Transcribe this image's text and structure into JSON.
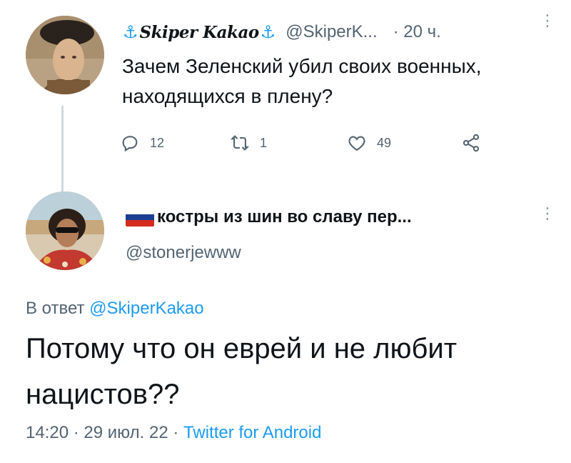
{
  "tweet1": {
    "display_name": "Skiper Kakao",
    "anchor_glyph": "⚓",
    "handle": "@SkiperK...",
    "time": "· 20 ч.",
    "text": "Зачем Зеленский убил своих военных, находящихся в плену?",
    "replies": "12",
    "retweets": "1",
    "likes": "49"
  },
  "tweet2": {
    "display_name": "костры из шин во славу пер...",
    "handle": "@stonerjewww",
    "reply_prefix": "В ответ",
    "reply_handle": "@SkiperKakao",
    "text": "Потому что он еврей и не любит нацистов??",
    "time": "14:20",
    "date": "29 июл. 22",
    "source": "Twitter for Android",
    "separator": "·"
  },
  "more_glyph": "⋮",
  "colors": {
    "accent": "#1d9bf0",
    "muted": "#536471",
    "text": "#0f1419",
    "thread_line": "#cfd9de"
  },
  "icons": [
    "reply-icon",
    "retweet-icon",
    "like-icon",
    "share-icon",
    "more-icon",
    "anchor-icon",
    "russian-flag-icon"
  ]
}
